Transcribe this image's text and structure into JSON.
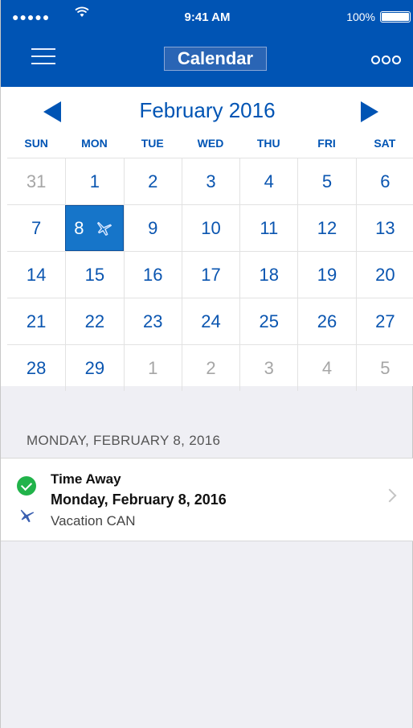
{
  "status_bar": {
    "signal": "●●●●●",
    "wifi_icon": "wifi-icon",
    "time": "9:41 AM",
    "battery_percent": "100%"
  },
  "nav": {
    "title": "Calendar",
    "menu_icon": "hamburger-icon",
    "more_icon": "more-icon"
  },
  "calendar": {
    "month_label": "February 2016",
    "weekdays": [
      "SUN",
      "MON",
      "TUE",
      "WED",
      "THU",
      "FRI",
      "SAT"
    ],
    "weeks": [
      [
        "31",
        "1",
        "2",
        "3",
        "4",
        "5",
        "6"
      ],
      [
        "7",
        "8",
        "9",
        "10",
        "11",
        "12",
        "13"
      ],
      [
        "14",
        "15",
        "16",
        "17",
        "18",
        "19",
        "20"
      ],
      [
        "21",
        "22",
        "23",
        "24",
        "25",
        "26",
        "27"
      ],
      [
        "28",
        "29",
        "1",
        "2",
        "3",
        "4",
        "5"
      ]
    ],
    "selected_day": "8",
    "accent_color": "#0054b4",
    "selected_color": "#1675c9"
  },
  "agenda": {
    "heading": "MONDAY, FEBRUARY 8, 2016",
    "event": {
      "title": "Time Away",
      "date": "Monday, February 8, 2016",
      "subtitle": "Vacation CAN",
      "status_color": "#21b34a"
    }
  }
}
